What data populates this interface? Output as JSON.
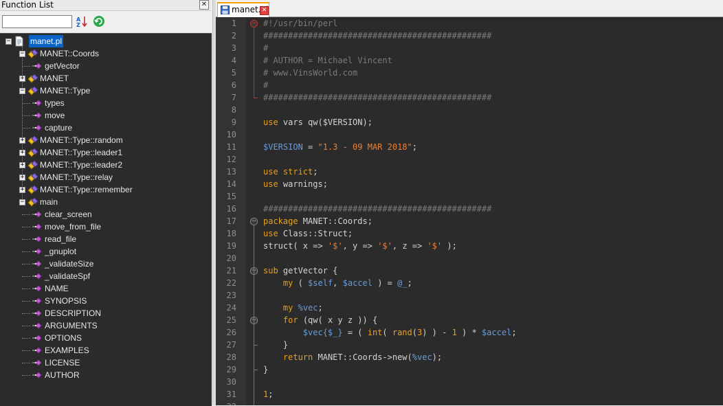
{
  "function_list": {
    "title": "Function List",
    "search_value": "",
    "tree": [
      {
        "label": "manet.pl",
        "level": 0,
        "expanded": true,
        "selected": true,
        "icon": "file-icon"
      },
      {
        "label": "MANET::Coords",
        "level": 1,
        "expanded": true,
        "icon": "class-icon"
      },
      {
        "label": "getVector",
        "level": 2,
        "icon": "function-icon"
      },
      {
        "label": "MANET",
        "level": 1,
        "expanded": false,
        "icon": "class-icon"
      },
      {
        "label": "MANET::Type",
        "level": 1,
        "expanded": true,
        "icon": "class-icon"
      },
      {
        "label": "types",
        "level": 2,
        "icon": "function-icon"
      },
      {
        "label": "move",
        "level": 2,
        "icon": "function-icon"
      },
      {
        "label": "capture",
        "level": 2,
        "icon": "function-icon"
      },
      {
        "label": "MANET::Type::random",
        "level": 1,
        "expanded": false,
        "icon": "class-icon"
      },
      {
        "label": "MANET::Type::leader1",
        "level": 1,
        "expanded": false,
        "icon": "class-icon"
      },
      {
        "label": "MANET::Type::leader2",
        "level": 1,
        "expanded": false,
        "icon": "class-icon"
      },
      {
        "label": "MANET::Type::relay",
        "level": 1,
        "expanded": false,
        "icon": "class-icon"
      },
      {
        "label": "MANET::Type::remember",
        "level": 1,
        "expanded": false,
        "icon": "class-icon"
      },
      {
        "label": "main",
        "level": 1,
        "expanded": true,
        "icon": "class-icon"
      },
      {
        "label": "clear_screen",
        "level": 2,
        "icon": "function-icon"
      },
      {
        "label": "move_from_file",
        "level": 2,
        "icon": "function-icon"
      },
      {
        "label": "read_file",
        "level": 2,
        "icon": "function-icon"
      },
      {
        "label": "_gnuplot",
        "level": 2,
        "icon": "function-icon"
      },
      {
        "label": "_validateSize",
        "level": 2,
        "icon": "function-icon"
      },
      {
        "label": "_validateSpf",
        "level": 2,
        "icon": "function-icon"
      },
      {
        "label": "NAME",
        "level": 2,
        "icon": "function-icon"
      },
      {
        "label": "SYNOPSIS",
        "level": 2,
        "icon": "function-icon"
      },
      {
        "label": "DESCRIPTION",
        "level": 2,
        "icon": "function-icon"
      },
      {
        "label": "ARGUMENTS",
        "level": 2,
        "icon": "function-icon"
      },
      {
        "label": "OPTIONS",
        "level": 2,
        "icon": "function-icon"
      },
      {
        "label": "EXAMPLES",
        "level": 2,
        "icon": "function-icon"
      },
      {
        "label": "LICENSE",
        "level": 2,
        "icon": "function-icon"
      },
      {
        "label": "AUTHOR",
        "level": 2,
        "icon": "function-icon"
      }
    ]
  },
  "editor": {
    "tab_label": "manet.pl",
    "lines": [
      [
        [
          "c",
          "#!/usr/bin/perl"
        ]
      ],
      [
        [
          "c",
          "##############################################"
        ]
      ],
      [
        [
          "c",
          "#"
        ]
      ],
      [
        [
          "c",
          "# AUTHOR = Michael Vincent"
        ]
      ],
      [
        [
          "c",
          "# www.VinsWorld.com"
        ]
      ],
      [
        [
          "c",
          "#"
        ]
      ],
      [
        [
          "c",
          "##############################################"
        ]
      ],
      [],
      [
        [
          "k",
          "use"
        ],
        [
          "o",
          " vars qw($VERSION);"
        ]
      ],
      [],
      [
        [
          "v",
          "$VERSION"
        ],
        [
          "o",
          " = "
        ],
        [
          "s",
          "\"1.3 - 09 MAR 2018\""
        ],
        [
          "o",
          ";"
        ]
      ],
      [],
      [
        [
          "k",
          "use strict"
        ],
        [
          "o",
          ";"
        ]
      ],
      [
        [
          "k",
          "use"
        ],
        [
          "o",
          " warnings;"
        ]
      ],
      [],
      [
        [
          "c",
          "##############################################"
        ]
      ],
      [
        [
          "k",
          "package"
        ],
        [
          "o",
          " MANET::Coords;"
        ]
      ],
      [
        [
          "k",
          "use"
        ],
        [
          "o",
          " Class::Struct;"
        ]
      ],
      [
        [
          "o",
          "struct( x => "
        ],
        [
          "s",
          "'$'"
        ],
        [
          "o",
          ", y => "
        ],
        [
          "s",
          "'$'"
        ],
        [
          "o",
          ", z => "
        ],
        [
          "s",
          "'$'"
        ],
        [
          "o",
          " );"
        ]
      ],
      [],
      [
        [
          "k",
          "sub"
        ],
        [
          "o",
          " getVector {"
        ]
      ],
      [
        [
          "o",
          "    "
        ],
        [
          "k",
          "my"
        ],
        [
          "o",
          " ( "
        ],
        [
          "v",
          "$self"
        ],
        [
          "o",
          ", "
        ],
        [
          "v",
          "$accel"
        ],
        [
          "o",
          " ) = "
        ],
        [
          "v",
          "@_"
        ],
        [
          "o",
          ";"
        ]
      ],
      [],
      [
        [
          "o",
          "    "
        ],
        [
          "k",
          "my"
        ],
        [
          "o",
          " "
        ],
        [
          "v",
          "%vec"
        ],
        [
          "o",
          ";"
        ]
      ],
      [
        [
          "o",
          "    "
        ],
        [
          "k",
          "for"
        ],
        [
          "o",
          " (qw( x y z )) {"
        ]
      ],
      [
        [
          "o",
          "        "
        ],
        [
          "v",
          "$vec{$_}"
        ],
        [
          "o",
          " = ( "
        ],
        [
          "k",
          "int"
        ],
        [
          "o",
          "( "
        ],
        [
          "k",
          "rand"
        ],
        [
          "o",
          "("
        ],
        [
          "n",
          "3"
        ],
        [
          "o",
          ") ) - "
        ],
        [
          "n",
          "1"
        ],
        [
          "o",
          " ) * "
        ],
        [
          "v",
          "$accel"
        ],
        [
          "o",
          ";"
        ]
      ],
      [
        [
          "o",
          "    }"
        ]
      ],
      [
        [
          "o",
          "    "
        ],
        [
          "k",
          "return"
        ],
        [
          "o",
          " MANET::Coords->new("
        ],
        [
          "v",
          "%vec"
        ],
        [
          "o",
          ");"
        ]
      ],
      [
        [
          "o",
          "}"
        ]
      ],
      [],
      [
        [
          "n",
          "1"
        ],
        [
          "o",
          ";"
        ]
      ],
      []
    ]
  },
  "colors": {
    "keyword": "#e8a020",
    "variable": "#6a9cd8",
    "string": "#e8813a",
    "comment": "#7a7a7a",
    "background": "#2b2b2b",
    "selection": "#0a64c8"
  }
}
